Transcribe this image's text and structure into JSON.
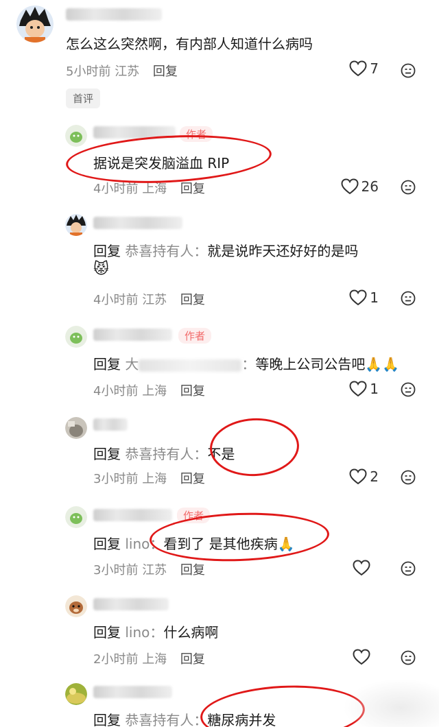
{
  "first_tag": "首评",
  "comments": [
    {
      "text": "怎么这么突然啊，有内部人知道什么病吗",
      "time": "5小时前",
      "location": "江苏",
      "reply_label": "回复",
      "likes": "7"
    },
    {
      "author_badge": "作者",
      "text": "据说是突发脑溢血 RIP",
      "time": "4小时前",
      "location": "上海",
      "reply_label": "回复",
      "likes": "26"
    },
    {
      "reply_word": "回复",
      "reply_target": "恭喜持有人：",
      "text": "就是说昨天还好好的是吗",
      "time": "4小时前",
      "location": "江苏",
      "reply_label": "回复",
      "likes": "1"
    },
    {
      "author_badge": "作者",
      "reply_word": "回复",
      "reply_target_prefix": "大",
      "text": "等晚上公司公告吧",
      "time": "4小时前",
      "location": "上海",
      "reply_label": "回复",
      "likes": "1"
    },
    {
      "reply_word": "回复",
      "reply_target": "恭喜持有人：",
      "text": "不是",
      "time": "3小时前",
      "location": "上海",
      "reply_label": "回复",
      "likes": "2"
    },
    {
      "author_badge": "作者",
      "reply_word": "回复",
      "reply_target": "lino：",
      "text": "看到了 是其他疾病",
      "time": "3小时前",
      "location": "江苏",
      "reply_label": "回复"
    },
    {
      "reply_word": "回复",
      "reply_target": "lino：",
      "text": "什么病啊",
      "time": "2小时前",
      "location": "上海",
      "reply_label": "回复"
    },
    {
      "reply_word": "回复",
      "reply_target": "恭喜持有人：",
      "text": "糖尿病并发"
    }
  ]
}
